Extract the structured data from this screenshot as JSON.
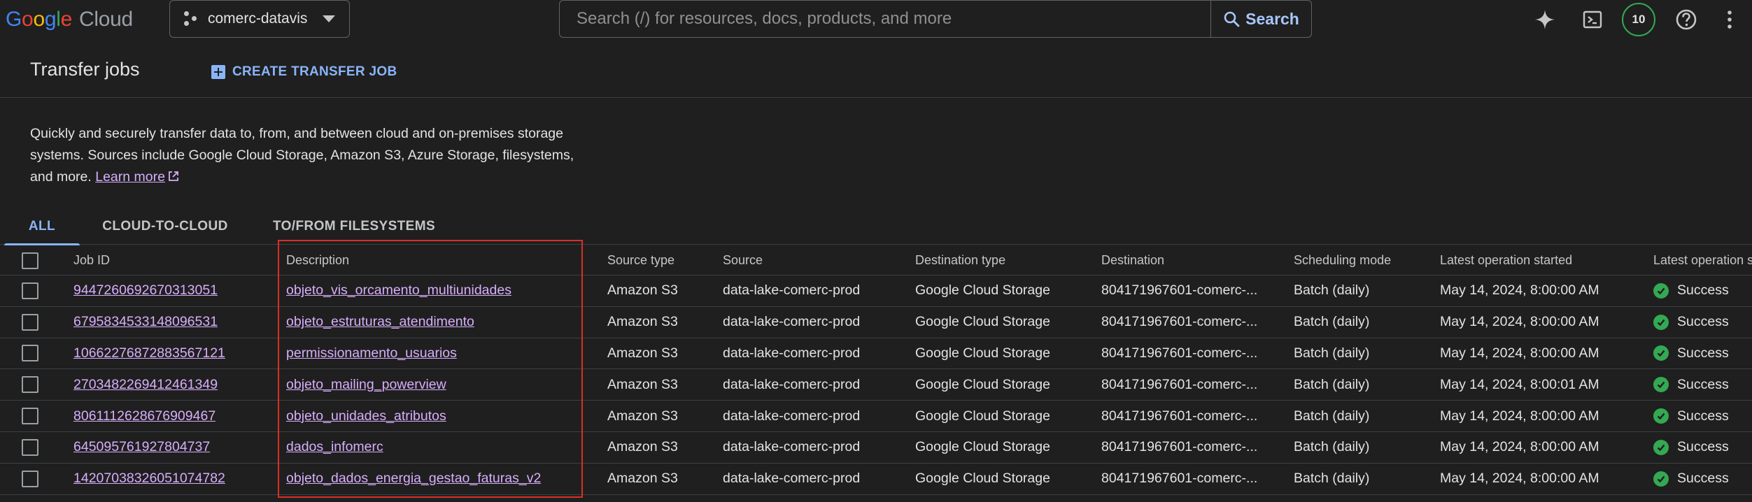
{
  "topbar": {
    "logo_google": [
      "G",
      "o",
      "o",
      "g",
      "l",
      "e"
    ],
    "logo_cloud": "Cloud",
    "project": "comerc-datavis",
    "search_placeholder": "Search (/) for resources, docs, products, and more",
    "search_label": "Search",
    "notifications_count": "10",
    "icons": [
      "gemini-sparkle-icon",
      "cloud-shell-icon",
      "help-icon",
      "more-vert-icon"
    ]
  },
  "header": {
    "title": "Transfer jobs",
    "create_label": "CREATE TRANSFER JOB"
  },
  "intro": {
    "text": "Quickly and securely transfer data to, from, and between cloud and on-premises storage systems. Sources include Google Cloud Storage, Amazon S3, Azure Storage, filesystems, and more.",
    "line1": "Quickly and securely transfer data to, from, and between cloud and on-premises storage",
    "line2": "systems. Sources include Google Cloud Storage, Amazon S3, Azure Storage, filesystems,",
    "line3": "and more.",
    "learn_more": "Learn more"
  },
  "tabs": [
    {
      "label": "ALL",
      "active": true
    },
    {
      "label": "CLOUD-TO-CLOUD",
      "active": false
    },
    {
      "label": "TO/FROM FILESYSTEMS",
      "active": false
    }
  ],
  "table": {
    "columns": [
      "Job ID",
      "Description",
      "Source type",
      "Source",
      "Destination type",
      "Destination",
      "Scheduling mode",
      "Latest operation started",
      "Latest operation s"
    ],
    "rows": [
      {
        "job_id": "9447260692670313051",
        "description": "objeto_vis_orcamento_multiunidades",
        "source_type": "Amazon S3",
        "source": "data-lake-comerc-prod",
        "destination_type": "Google Cloud Storage",
        "destination": "804171967601-comerc-...",
        "scheduling": "Batch (daily)",
        "started": "May 14, 2024, 8:00:00 AM",
        "status": "Success"
      },
      {
        "job_id": "6795834533148096531",
        "description": "objeto_estruturas_atendimento",
        "source_type": "Amazon S3",
        "source": "data-lake-comerc-prod",
        "destination_type": "Google Cloud Storage",
        "destination": "804171967601-comerc-...",
        "scheduling": "Batch (daily)",
        "started": "May 14, 2024, 8:00:00 AM",
        "status": "Success"
      },
      {
        "job_id": "10662276872883567121",
        "description": "permissionamento_usuarios",
        "source_type": "Amazon S3",
        "source": "data-lake-comerc-prod",
        "destination_type": "Google Cloud Storage",
        "destination": "804171967601-comerc-...",
        "scheduling": "Batch (daily)",
        "started": "May 14, 2024, 8:00:00 AM",
        "status": "Success"
      },
      {
        "job_id": "2703482269412461349",
        "description": "objeto_mailing_powerview",
        "source_type": "Amazon S3",
        "source": "data-lake-comerc-prod",
        "destination_type": "Google Cloud Storage",
        "destination": "804171967601-comerc-...",
        "scheduling": "Batch (daily)",
        "started": "May 14, 2024, 8:00:01 AM",
        "status": "Success"
      },
      {
        "job_id": "8061112628676909467",
        "description": "objeto_unidades_atributos",
        "source_type": "Amazon S3",
        "source": "data-lake-comerc-prod",
        "destination_type": "Google Cloud Storage",
        "destination": "804171967601-comerc-...",
        "scheduling": "Batch (daily)",
        "started": "May 14, 2024, 8:00:00 AM",
        "status": "Success"
      },
      {
        "job_id": "645095761927804737",
        "description": "dados_infomerc",
        "source_type": "Amazon S3",
        "source": "data-lake-comerc-prod",
        "destination_type": "Google Cloud Storage",
        "destination": "804171967601-comerc-...",
        "scheduling": "Batch (daily)",
        "started": "May 14, 2024, 8:00:00 AM",
        "status": "Success"
      },
      {
        "job_id": "14207038326051074782",
        "description": "objeto_dados_energia_gestao_faturas_v2",
        "source_type": "Amazon S3",
        "source": "data-lake-comerc-prod",
        "destination_type": "Google Cloud Storage",
        "destination": "804171967601-comerc-...",
        "scheduling": "Batch (daily)",
        "started": "May 14, 2024, 8:00:00 AM",
        "status": "Success"
      }
    ]
  },
  "colors": {
    "background": "#1f1f1f",
    "link": "#d7aefb",
    "accent": "#8ab4f8",
    "success": "#34a853",
    "highlight": "#d93025"
  }
}
